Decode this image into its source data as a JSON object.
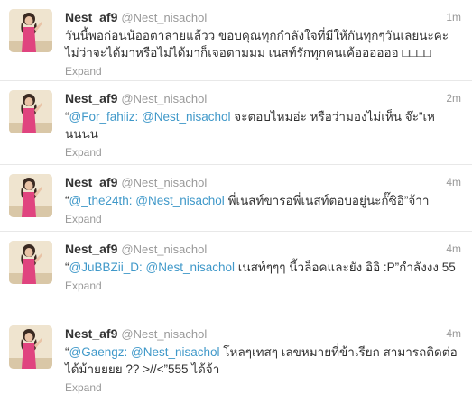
{
  "tweets": [
    {
      "fullname": "Nest_af9",
      "username": "@Nest_nisachol",
      "time": "1m",
      "quote_open": "",
      "mentions": [],
      "body": "วันนี้พอก่อนน้ออตาลายแล้วว ขอบคุณทุกกำลังใจที่มีให้กันทุกๆวันเลยนะคะ ไม่ว่าจะได้มาหรือไม่ได้มาก็เจอตามมม เนสท์รักทุกคนเค้ออออออ □□□□",
      "expand": "Expand"
    },
    {
      "fullname": "Nest_af9",
      "username": "@Nest_nisachol",
      "time": "2m",
      "quote_open": "“",
      "mentions": [
        "@For_fahiiz:",
        "@Nest_nisachol"
      ],
      "body": "จะตอบไหมอ่ะ หรือว่ามองไม่เห็น จ๊ะ”เหนนนน",
      "expand": "Expand"
    },
    {
      "fullname": "Nest_af9",
      "username": "@Nest_nisachol",
      "time": "4m",
      "quote_open": "“",
      "mentions": [
        "@_the24th:",
        "@Nest_nisachol"
      ],
      "body": "พี่เนสท์ขารอพี่เนสท์ตอบอยู่นะกั๊ซิอิ”จ้าา",
      "expand": "Expand"
    },
    {
      "fullname": "Nest_af9",
      "username": "@Nest_nisachol",
      "time": "4m",
      "quote_open": "“",
      "mentions": [
        "@JuBBZii_D:",
        "@Nest_nisachol"
      ],
      "body": "เนสท์ๆๆๆ นี้วล็อคและยัง อิอิ :P”กำลังงง 55",
      "expand": "Expand"
    },
    {
      "fullname": "Nest_af9",
      "username": "@Nest_nisachol",
      "time": "4m",
      "quote_open": "“",
      "mentions": [
        "@Gaengz:",
        "@Nest_nisachol"
      ],
      "body": "โหลๆเทสๆ เลขหมายที่ข้าเรียก สามารถติดต่อได้ม้ายยยย ?? >//<”555 ได้จ้า",
      "expand": "Expand"
    }
  ]
}
